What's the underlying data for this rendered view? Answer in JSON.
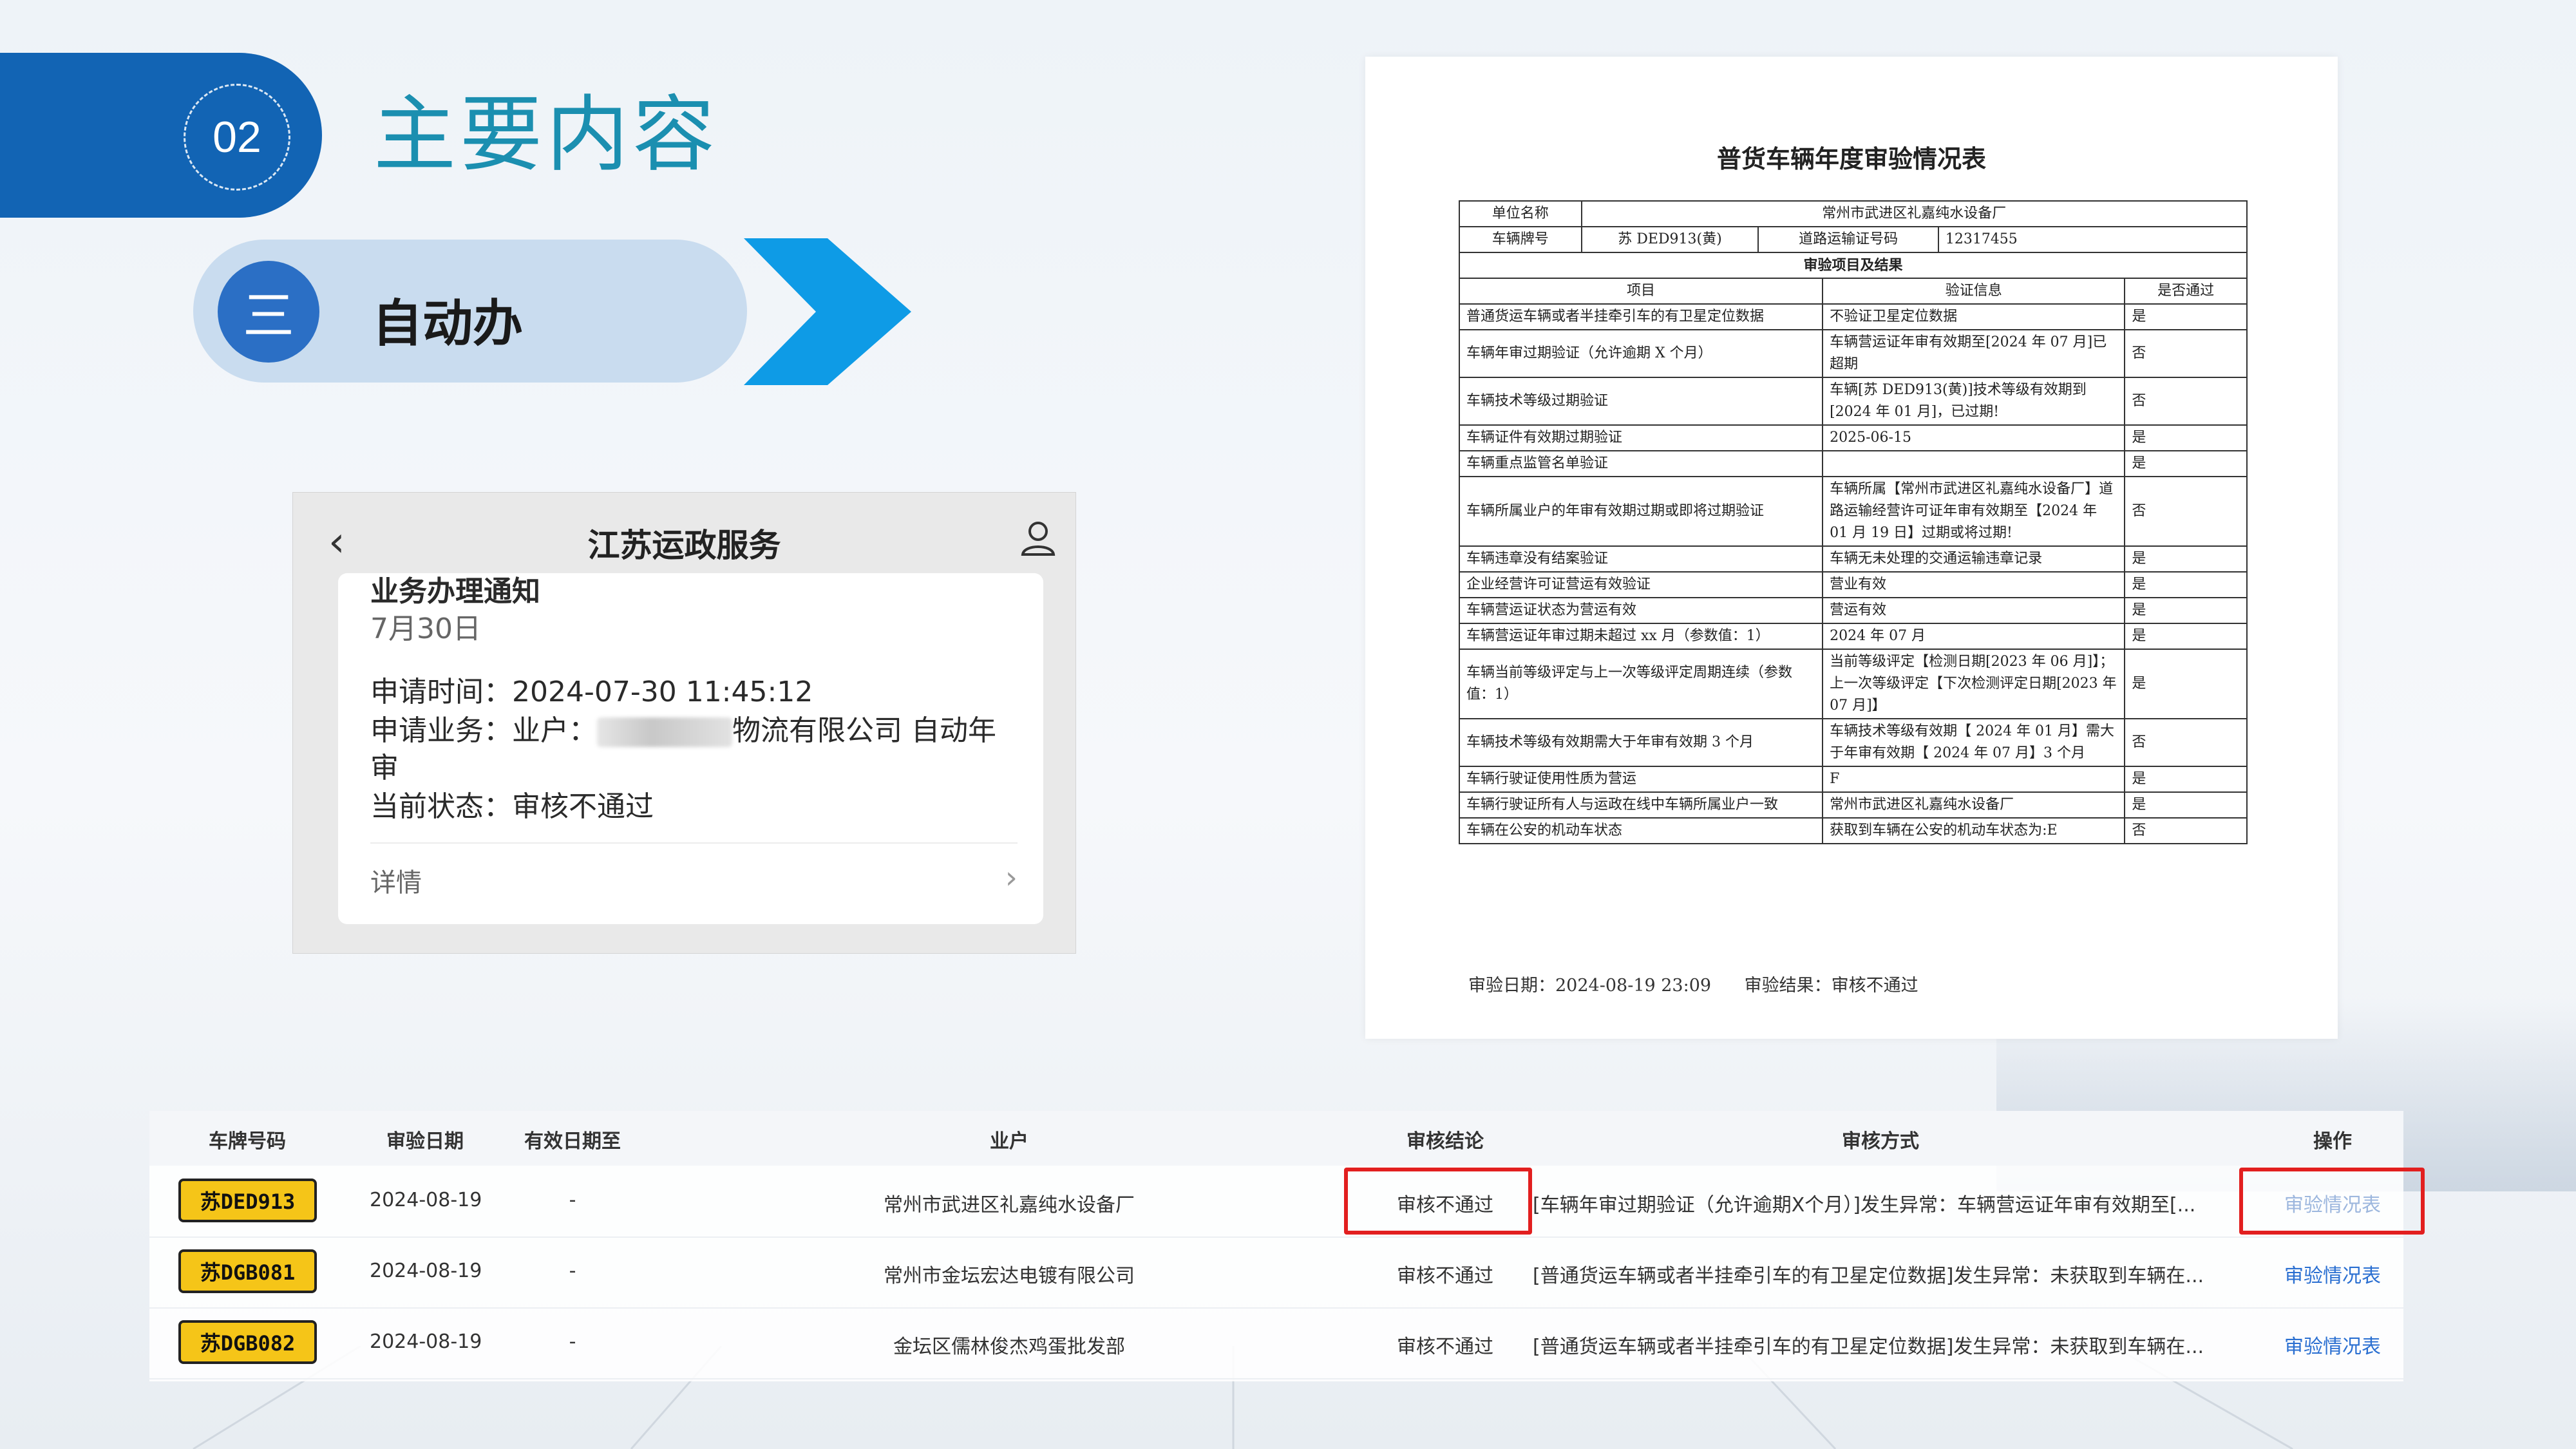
{
  "header": {
    "section_number": "02",
    "title": "主要内容",
    "sub_badge": "三",
    "sub_label": "自动办"
  },
  "phone": {
    "title": "江苏运政服务",
    "card": {
      "line1": "业务办理通知",
      "date": "7月30日",
      "apply_time_label": "申请时间：",
      "apply_time": "2024-07-30 11:45:12",
      "business_label": "申请业务：",
      "business_prefix": "业户：",
      "business_suffix": "物流有限公司 自动年",
      "business_wrap": "审",
      "status_label": "当前状态：",
      "status": "审核不通过",
      "details": "详情"
    }
  },
  "doc": {
    "title": "普货车辆年度审验情况表",
    "unit_label": "单位名称",
    "unit_value": "常州市武进区礼嘉纯水设备厂",
    "plate_label": "车辆牌号",
    "plate_value": "苏 DED913(黄)",
    "license_label": "道路运输证号码",
    "license_value": "12317455",
    "section_header": "审验项目及结果",
    "col_item": "项目",
    "col_info": "验证信息",
    "col_pass": "是否通过",
    "rows": [
      {
        "item": "普通货运车辆或者半挂牵引车的有卫星定位数据",
        "info": "不验证卫星定位数据",
        "pass": "是"
      },
      {
        "item": "车辆年审过期验证（允许逾期 X 个月）",
        "info": "车辆营运证年审有效期至[2024 年 07 月]已超期",
        "pass": "否"
      },
      {
        "item": "车辆技术等级过期验证",
        "info": "车辆[苏 DED913(黄)]技术等级有效期到[2024 年 01 月]，已过期!",
        "pass": "否"
      },
      {
        "item": "车辆证件有效期过期验证",
        "info": "2025-06-15",
        "pass": "是"
      },
      {
        "item": "车辆重点监管名单验证",
        "info": "",
        "pass": "是"
      },
      {
        "item": "车辆所属业户的年审有效期过期或即将过期验证",
        "info": "车辆所属【常州市武进区礼嘉纯水设备厂】道路运输经营许可证年审有效期至【2024 年 01 月 19 日】过期或将过期!",
        "pass": "否"
      },
      {
        "item": "车辆违章没有结案验证",
        "info": "车辆无未处理的交通运输违章记录",
        "pass": "是"
      },
      {
        "item": "企业经营许可证营运有效验证",
        "info": "营业有效",
        "pass": "是"
      },
      {
        "item": "车辆营运证状态为营运有效",
        "info": "营运有效",
        "pass": "是"
      },
      {
        "item": "车辆营运证年审过期未超过 xx 月（参数值：1）",
        "info": "2024 年 07 月",
        "pass": "是"
      },
      {
        "item": "车辆当前等级评定与上一次等级评定周期连续（参数值：1）",
        "info": "当前等级评定【检测日期[2023 年 06 月]】；上一次等级评定【下次检测评定日期[2023 年 07 月]】",
        "pass": "是"
      },
      {
        "item": "车辆技术等级有效期需大于年审有效期 3 个月",
        "info": "车辆技术等级有效期【 2024 年 01 月】需大于年审有效期【 2024 年 07 月】3 个月",
        "pass": "否"
      },
      {
        "item": "车辆行驶证使用性质为营运",
        "info": "F",
        "pass": "是"
      },
      {
        "item": "车辆行驶证所有人与运政在线中车辆所属业户一致",
        "info": "常州市武进区礼嘉纯水设备厂",
        "pass": "是"
      },
      {
        "item": "车辆在公安的机动车状态",
        "info": "获取到车辆在公安的机动车状态为:E",
        "pass": "否"
      }
    ],
    "footer_date_label": "审验日期：",
    "footer_date": "2024-08-19 23:09",
    "footer_result_label": "审验结果：",
    "footer_result": "审核不通过"
  },
  "result_table": {
    "headers": [
      "车牌号码",
      "审验日期",
      "有效日期至",
      "业户",
      "审核结论",
      "审核方式",
      "操作"
    ],
    "rows": [
      {
        "plate": "苏DED913",
        "date": "2024-08-19",
        "valid": "-",
        "owner": "常州市武进区礼嘉纯水设备厂",
        "conclusion": "审核不通过",
        "method": "[车辆年审过期验证（允许逾期X个月）]发生异常：车辆营运证年审有效期至[...",
        "action": "审验情况表"
      },
      {
        "plate": "苏DGB081",
        "date": "2024-08-19",
        "valid": "-",
        "owner": "常州市金坛宏达电镀有限公司",
        "conclusion": "审核不通过",
        "method": "[普通货运车辆或者半挂牵引车的有卫星定位数据]发生异常：未获取到车辆在...",
        "action": "审验情况表"
      },
      {
        "plate": "苏DGB082",
        "date": "2024-08-19",
        "valid": "-",
        "owner": "金坛区儒林俊杰鸡蛋批发部",
        "conclusion": "审核不通过",
        "method": "[普通货运车辆或者半挂牵引车的有卫星定位数据]发生异常：未获取到车辆在...",
        "action": "审验情况表"
      }
    ]
  },
  "colors": {
    "primary_blue": "#1264b4",
    "title_teal": "#1b8fb0",
    "chevron_blue": "#0e9be6",
    "plate_yellow": "#f5c518",
    "highlight_red": "#e21f1f",
    "link_blue": "#2a6fd1"
  }
}
